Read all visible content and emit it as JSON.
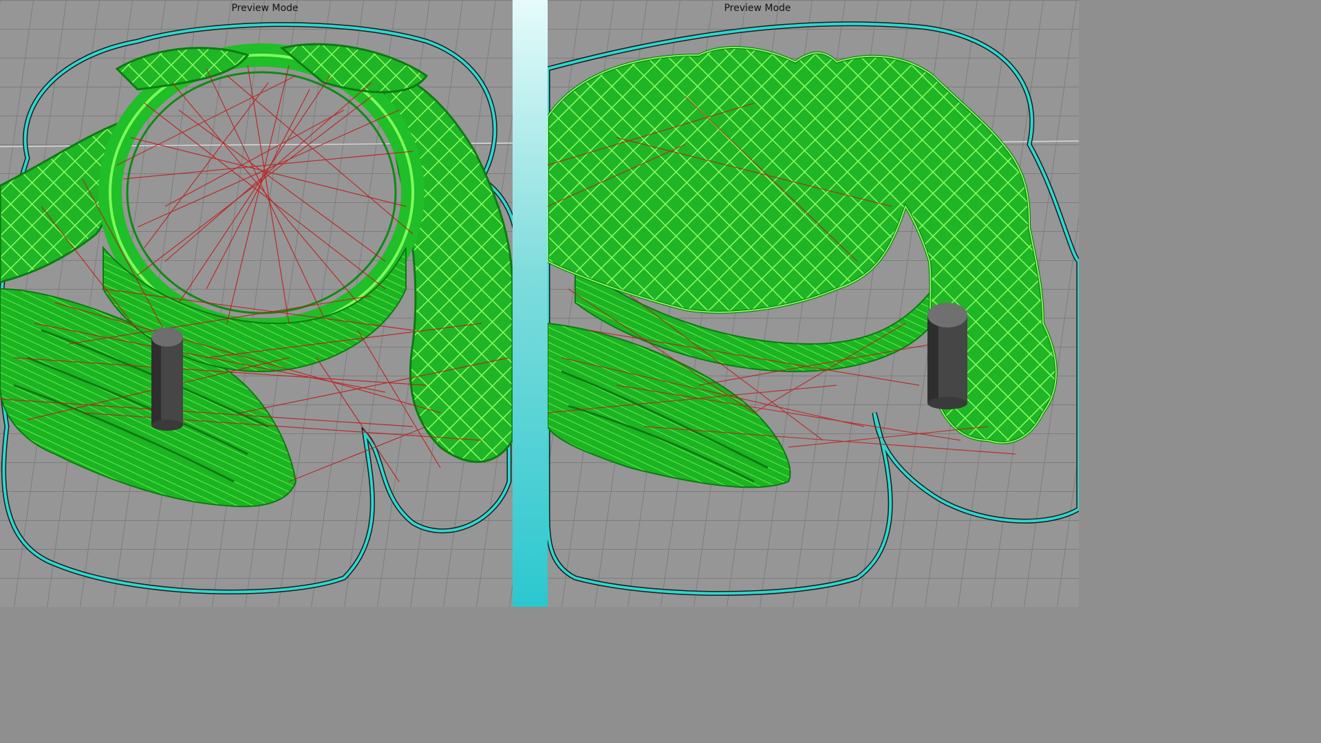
{
  "panels": [
    {
      "id": "left",
      "mode_label": "Preview Mode",
      "layer_state": "partial-layer-with-travel-moves"
    },
    {
      "id": "right",
      "mode_label": "Preview Mode",
      "layer_state": "infill-layer"
    }
  ],
  "colors": {
    "build_plate": "#969696",
    "grid_line": "#7a7a7a",
    "extrusion": "#22c92a",
    "extrusion_highlight": "#7dff5a",
    "travel_move": "#c01818",
    "skirt": "#2fd6d0",
    "support_pillar": "#4a4a4a",
    "divider": "#2bc8cf"
  }
}
